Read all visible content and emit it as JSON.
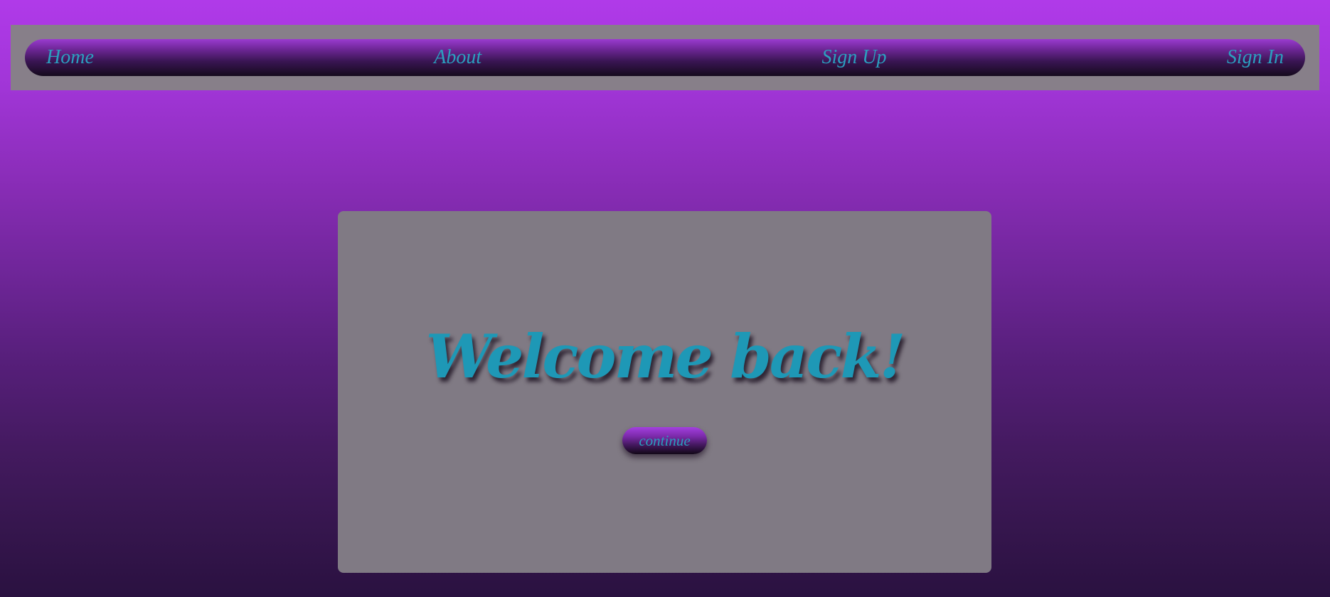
{
  "nav": {
    "items": [
      {
        "label": "Home"
      },
      {
        "label": "About"
      },
      {
        "label": "Sign Up"
      },
      {
        "label": "Sign In"
      }
    ]
  },
  "main": {
    "heading": "Welcome back!",
    "continue_label": "continue"
  },
  "colors": {
    "text_accent": "#2b9fbf",
    "background_top": "#b03ae9",
    "background_bottom": "#2a1140",
    "panel": "#807a84"
  }
}
